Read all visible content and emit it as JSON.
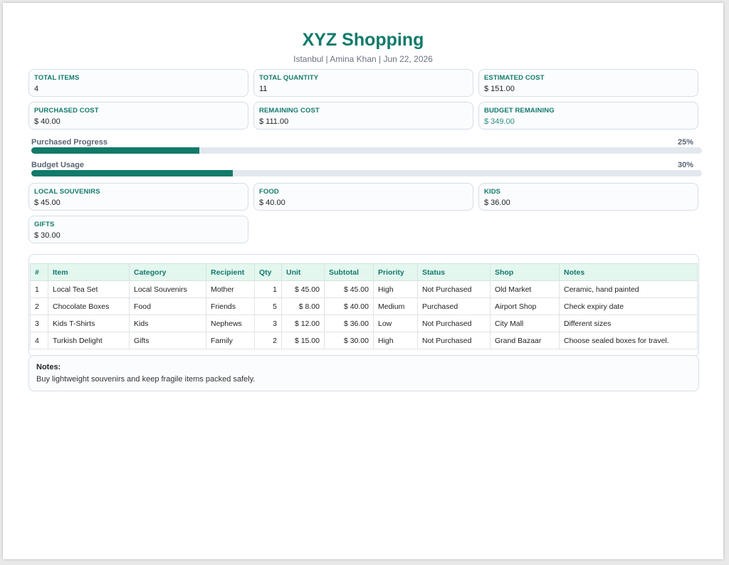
{
  "header": {
    "title": "XYZ Shopping",
    "subtitle": "Istanbul | Amina Khan | Jun 22, 2026"
  },
  "summary": [
    {
      "label": "TOTAL ITEMS",
      "value": "4"
    },
    {
      "label": "TOTAL QUANTITY",
      "value": "11"
    },
    {
      "label": "ESTIMATED COST",
      "value": "$ 151.00"
    },
    {
      "label": "PURCHASED COST",
      "value": "$ 40.00"
    },
    {
      "label": "REMAINING COST",
      "value": "$ 111.00"
    },
    {
      "label": "BUDGET REMAINING",
      "value": "$ 349.00"
    }
  ],
  "progress": [
    {
      "label": "Purchased Progress",
      "percent_text": "25%",
      "fraction": 0.25
    },
    {
      "label": "Budget Usage",
      "percent_text": "30%",
      "fraction": 0.3
    }
  ],
  "categories": [
    {
      "label": "LOCAL SOUVENIRS",
      "value": "$ 45.00"
    },
    {
      "label": "FOOD",
      "value": "$ 40.00"
    },
    {
      "label": "KIDS",
      "value": "$ 36.00"
    },
    {
      "label": "GIFTS",
      "value": "$ 30.00"
    }
  ],
  "table": {
    "headers": [
      "#",
      "Item",
      "Category",
      "Recipient",
      "Qty",
      "Unit",
      "Subtotal",
      "Priority",
      "Status",
      "Shop",
      "Notes"
    ],
    "rows": [
      [
        "1",
        "Local Tea Set",
        "Local Souvenirs",
        "Mother",
        "1",
        "$ 45.00",
        "$ 45.00",
        "High",
        "Not Purchased",
        "Old Market",
        "Ceramic, hand painted"
      ],
      [
        "2",
        "Chocolate Boxes",
        "Food",
        "Friends",
        "5",
        "$ 8.00",
        "$ 40.00",
        "Medium",
        "Purchased",
        "Airport Shop",
        "Check expiry date"
      ],
      [
        "3",
        "Kids T-Shirts",
        "Kids",
        "Nephews",
        "3",
        "$ 12.00",
        "$ 36.00",
        "Low",
        "Not Purchased",
        "City Mall",
        "Different sizes"
      ],
      [
        "4",
        "Turkish Delight",
        "Gifts",
        "Family",
        "2",
        "$ 15.00",
        "$ 30.00",
        "High",
        "Not Purchased",
        "Grand Bazaar",
        "Choose sealed boxes for travel."
      ]
    ]
  },
  "notes": {
    "heading": "Notes:",
    "body": "Buy lightweight souvenirs and keep fragile items packed safely."
  },
  "colors": {
    "accent": "#127a6a",
    "track": "#e3e8ef"
  }
}
